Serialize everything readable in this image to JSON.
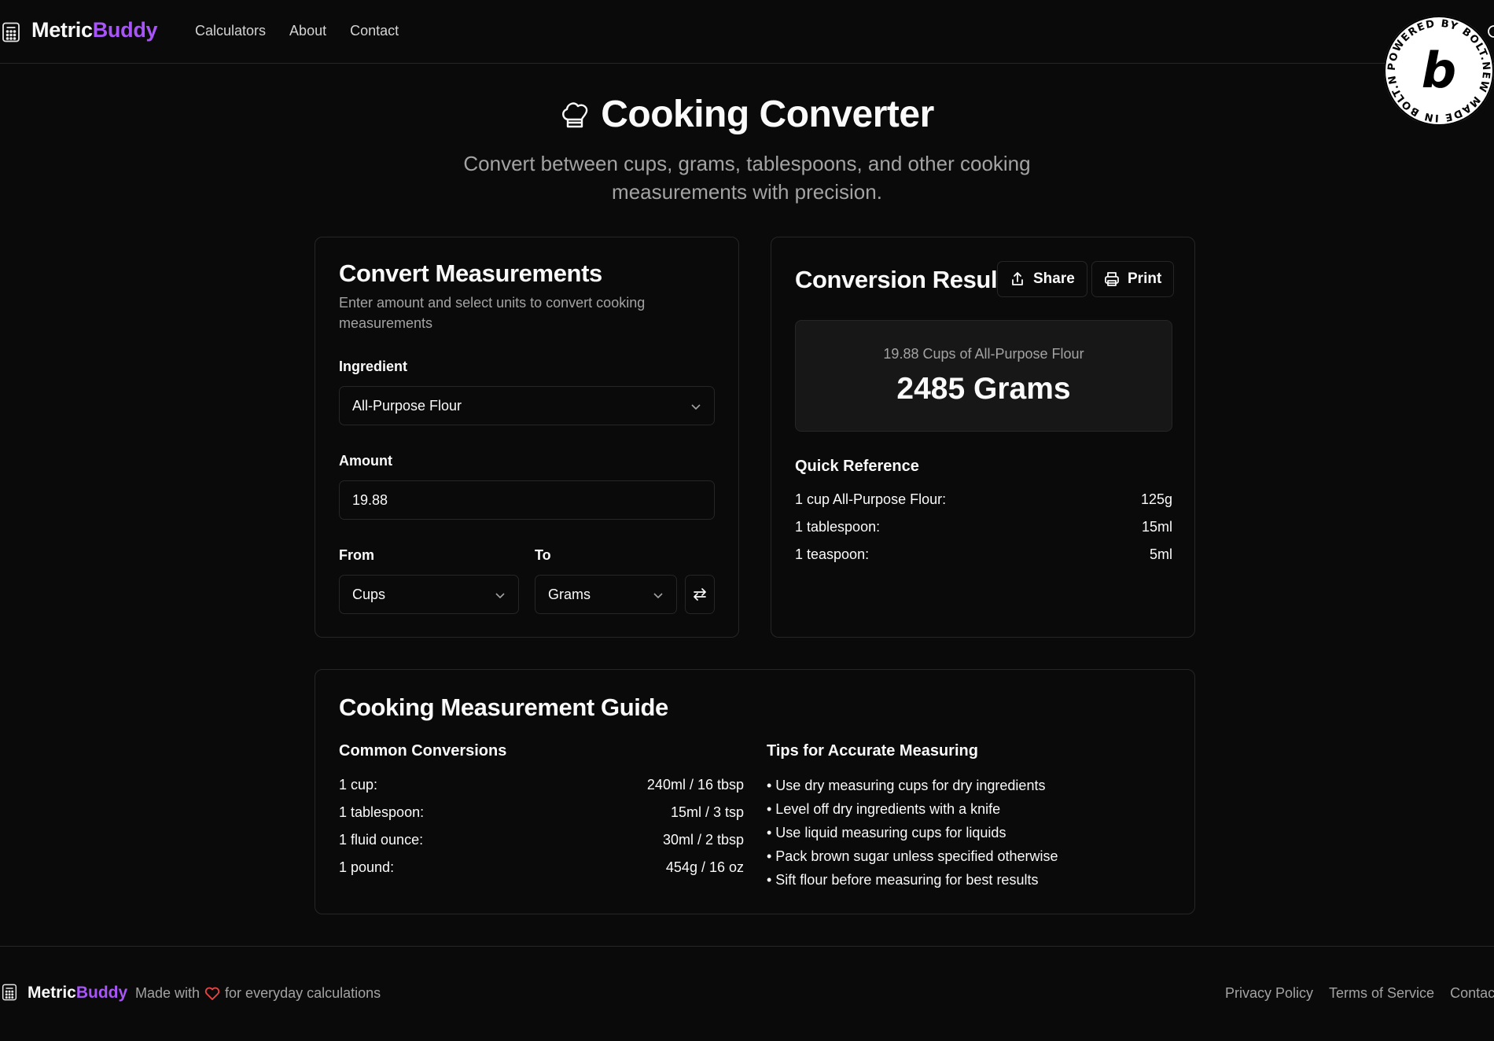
{
  "nav": {
    "brand_part1": "Metric",
    "brand_part2": "Buddy",
    "links": [
      "Calculators",
      "About",
      "Contact"
    ],
    "logo_icon": "calculator-icon",
    "theme_toggle_icon": "moon-icon",
    "badge_text": "POWERED BY BOLT.NEW MADE IN BOLT.NEW",
    "badge_letter": "b"
  },
  "hero": {
    "icon": "chef-hat-icon",
    "title": "Cooking Converter",
    "subtitle": "Convert between cups, grams, tablespoons, and other cooking measurements with precision."
  },
  "convert": {
    "title": "Convert Measurements",
    "description": "Enter amount and select units to convert cooking measurements",
    "ingredient_label": "Ingredient",
    "ingredient_value": "All-Purpose Flour",
    "amount_label": "Amount",
    "amount_value": "19.88",
    "from_label": "From",
    "from_value": "Cups",
    "to_label": "To",
    "to_value": "Grams",
    "swap_icon": "arrow-left-right-icon"
  },
  "result": {
    "title": "Conversion Result",
    "share_label": "Share",
    "print_label": "Print",
    "caption": "19.88 Cups of All-Purpose Flour",
    "value": "2485 Grams",
    "quick_ref_title": "Quick Reference",
    "quick_ref": [
      {
        "label": "1 cup All-Purpose Flour:",
        "value": "125g"
      },
      {
        "label": "1 tablespoon:",
        "value": "15ml"
      },
      {
        "label": "1 teaspoon:",
        "value": "5ml"
      }
    ]
  },
  "guide": {
    "title": "Cooking Measurement Guide",
    "common_title": "Common Conversions",
    "common": [
      {
        "label": "1 cup:",
        "value": "240ml / 16 tbsp"
      },
      {
        "label": "1 tablespoon:",
        "value": "15ml / 3 tsp"
      },
      {
        "label": "1 fluid ounce:",
        "value": "30ml / 2 tbsp"
      },
      {
        "label": "1 pound:",
        "value": "454g / 16 oz"
      }
    ],
    "tips_title": "Tips for Accurate Measuring",
    "tips": [
      "• Use dry measuring cups for dry ingredients",
      "• Level off dry ingredients with a knife",
      "• Use liquid measuring cups for liquids",
      "• Pack brown sugar unless specified otherwise",
      "• Sift flour before measuring for best results"
    ]
  },
  "footer": {
    "brand_part1": "Metric",
    "brand_part2": "Buddy",
    "made_prefix": "Made with",
    "made_suffix": "for everyday calculations",
    "heart_icon": "heart-icon",
    "links": [
      "Privacy Policy",
      "Terms of Service",
      "Contact"
    ]
  },
  "colors": {
    "background": "#0a0a0a",
    "accent": "#a855f7",
    "border": "#262626",
    "muted_text": "#a3a3a3",
    "heart": "#ef4444"
  }
}
